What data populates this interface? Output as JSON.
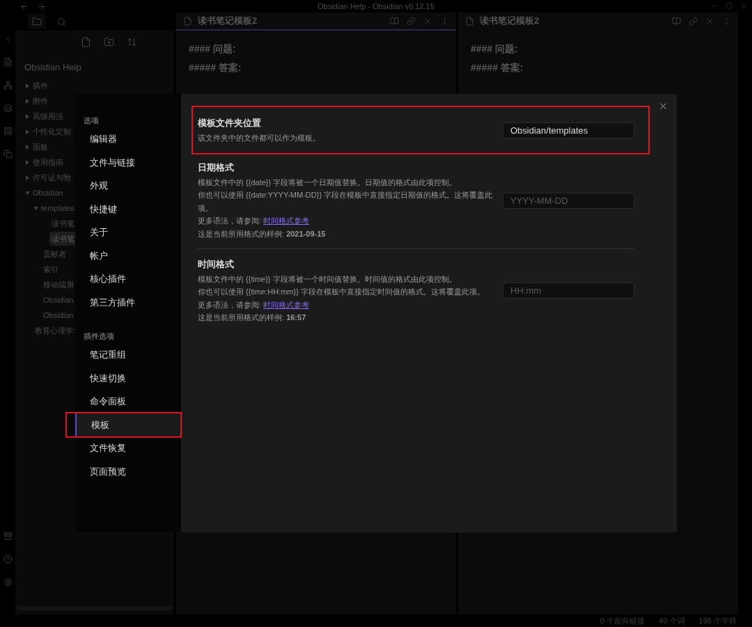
{
  "window": {
    "title": "Obsidian Help - Obsidian v0.12.15"
  },
  "file_explorer": {
    "vault": "Obsidian Help",
    "tree": [
      {
        "kind": "folder",
        "label": "插件",
        "expanded": false
      },
      {
        "kind": "folder",
        "label": "附件",
        "expanded": false
      },
      {
        "kind": "folder",
        "label": "高级用法",
        "expanded": false
      },
      {
        "kind": "folder",
        "label": "个性化定制",
        "expanded": false
      },
      {
        "kind": "folder",
        "label": "面板",
        "expanded": false
      },
      {
        "kind": "folder",
        "label": "使用指南",
        "expanded": false
      },
      {
        "kind": "folder",
        "label": "许可证与附",
        "expanded": false
      },
      {
        "kind": "folder",
        "label": "Obsidian",
        "expanded": true,
        "children": [
          {
            "kind": "folder",
            "label": "templates",
            "expanded": true,
            "children": [
              {
                "kind": "file",
                "label": "读书笔",
                "selected": false
              },
              {
                "kind": "file",
                "label": "读书笔",
                "selected": true
              }
            ]
          },
          {
            "kind": "file",
            "label": "贡献者",
            "selected": false
          },
          {
            "kind": "file",
            "label": "索引",
            "selected": false
          },
          {
            "kind": "file",
            "label": "移动端测",
            "selected": false
          },
          {
            "kind": "file",
            "label": "Obsidian",
            "selected": false
          },
          {
            "kind": "file",
            "label": "Obsidian",
            "selected": false
          }
        ]
      },
      {
        "kind": "file",
        "label": "教育心理学:",
        "selected": false
      }
    ]
  },
  "panes": [
    {
      "title": "读书笔记模板2",
      "active": true,
      "lines": [
        "#### 问题:",
        "##### 答案:"
      ]
    },
    {
      "title": "读书笔记模板2",
      "active": false,
      "lines": [
        "#### 问题:",
        "##### 答案:"
      ]
    }
  ],
  "status_bar": [
    "0 个反向链接",
    "40 个词",
    "198 个字符"
  ],
  "settings_dialog": {
    "nav": [
      {
        "heading": "选项",
        "items": [
          {
            "label": "编辑器",
            "selected": false,
            "highlighted": false
          },
          {
            "label": "文件与链接",
            "selected": false,
            "highlighted": false
          },
          {
            "label": "外观",
            "selected": false,
            "highlighted": false
          },
          {
            "label": "快捷键",
            "selected": false,
            "highlighted": false
          },
          {
            "label": "关于",
            "selected": false,
            "highlighted": false
          },
          {
            "label": "帐户",
            "selected": false,
            "highlighted": false
          },
          {
            "label": "核心插件",
            "selected": false,
            "highlighted": false
          },
          {
            "label": "第三方插件",
            "selected": false,
            "highlighted": false
          }
        ]
      },
      {
        "heading": "插件选项",
        "items": [
          {
            "label": "笔记重组",
            "selected": false,
            "highlighted": false
          },
          {
            "label": "快速切换",
            "selected": false,
            "highlighted": false
          },
          {
            "label": "命令面板",
            "selected": false,
            "highlighted": false
          },
          {
            "label": "模板",
            "selected": true,
            "highlighted": true
          },
          {
            "label": "文件恢复",
            "selected": false,
            "highlighted": false
          },
          {
            "label": "页面预览",
            "selected": false,
            "highlighted": false
          }
        ]
      }
    ],
    "settings": [
      {
        "name": "模板文件夹位置",
        "highlighted": true,
        "description": [
          {
            "text": "该文件夹中的文件都可以作为模板。"
          }
        ],
        "value": "Obsidian/templates"
      },
      {
        "name": "日期格式",
        "highlighted": false,
        "description": [
          {
            "text": "模板文件中的 {{date}} 字段将被一个日期值替换。日期值的格式由此项控制。"
          },
          {
            "text": "你也可以使用 {{date:YYYY-MM-DD}} 字段在模板中直接指定日期值的格式。这将覆盖此项。"
          },
          {
            "text": "更多语法，请参阅: ",
            "link": "时间格式参考"
          },
          {
            "text": "这是当前所用格式的样例: **2021-09-15**"
          }
        ],
        "placeholder": "YYYY-MM-DD"
      },
      {
        "name": "时间格式",
        "highlighted": false,
        "description": [
          {
            "text": "模板文件中的 {{time}} 字段将被一个时间值替换。时间值的格式由此项控制。"
          },
          {
            "text": "你也可以使用 {{time:HH:mm}} 字段在模板中直接指定时间值的格式。这将覆盖此项。"
          },
          {
            "text": "更多语法，请参阅: ",
            "link": "时间格式参考"
          },
          {
            "text": "这是当前所用格式的样例: **16:57**"
          }
        ],
        "placeholder": "HH:mm"
      }
    ]
  }
}
